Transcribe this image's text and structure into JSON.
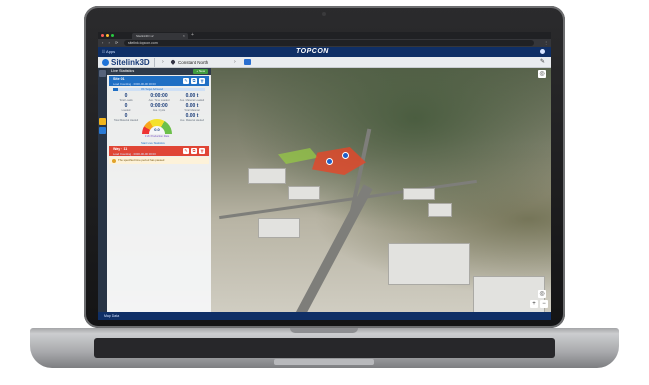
{
  "browser": {
    "tab_title": "Sitelink3D v2",
    "tab_close": "×",
    "new_tab": "+",
    "url": "sitelink.topcon.com",
    "nav_icons": "‹ › ⟳",
    "menu_icon": "⋮"
  },
  "header": {
    "apps_label": "⠿ Apps",
    "brand": "TOPCON",
    "product": "Sitelink3D",
    "project_name": "Constant North",
    "arrow": "›",
    "wrench_glyph": "✎"
  },
  "panel": {
    "title": "Live Statistics",
    "new_button": "+ New",
    "card": {
      "name": "Site 01",
      "subtitle": "Load Counting · 0000-00-00 00:00",
      "progress_label": "0% Target Achieved",
      "progress_fraction": 0.05,
      "edit_glyph": "✎",
      "copy_glyph": "⧉",
      "delete_glyph": "🗑"
    },
    "stats": [
      {
        "value": "0",
        "label": "Total Loads"
      },
      {
        "value": "0:00:00",
        "label": "Ave. Time Loaded"
      },
      {
        "value": "0.00 t",
        "label": "Ave. Material Loaded"
      },
      {
        "value": "0",
        "label": "Loaded"
      },
      {
        "value": "0:00:00",
        "label": "Ave. Cycle"
      },
      {
        "value": "0.00 t",
        "label": "Total Material"
      },
      {
        "value": "0",
        "label": "Total Material Hauled"
      },
      {
        "value": "0.00 t",
        "label": "Ave. Material Hauled"
      }
    ],
    "gauge": {
      "value": "0.0",
      "caption": "0 t/h Production Rate",
      "fraction": 0.55
    },
    "link_text": "Start Live Statistics",
    "alert": {
      "title": "Way · 11",
      "subtitle": "Load Counting · 0000-00-00 00:00",
      "message": "The specified time period has passed"
    }
  },
  "map": {
    "status_text": "Map Data",
    "layers_glyph": "◎",
    "zoom_in": "+",
    "zoom_out": "−"
  },
  "colors": {
    "header_blue": "#0f2f66",
    "accent_blue": "#1f6fc4",
    "alert_red": "#e04535",
    "zone_red": "#e64628",
    "zone_green": "#96c846"
  }
}
